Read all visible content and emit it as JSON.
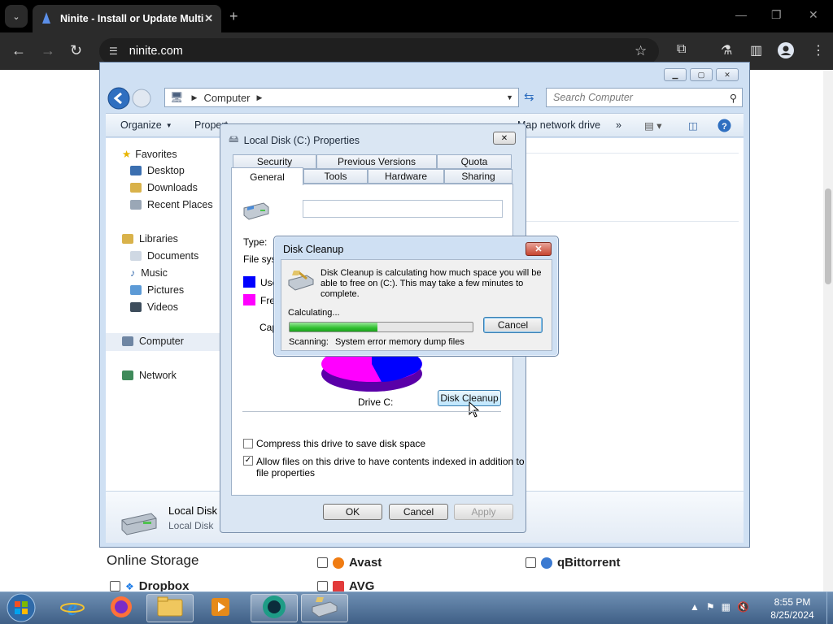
{
  "browser": {
    "tab_title": "Ninite - Install or Update Multi",
    "url": "ninite.com"
  },
  "explorer": {
    "address": "Computer",
    "search_placeholder": "Search Computer",
    "toolbar": {
      "organize": "Organize",
      "properties": "Propert",
      "map_drive": "Map network drive",
      "more": "»"
    },
    "nav": {
      "favorites": "Favorites",
      "desktop": "Desktop",
      "downloads": "Downloads",
      "recent": "Recent Places",
      "libraries": "Libraries",
      "documents": "Documents",
      "music": "Music",
      "pictures": "Pictures",
      "videos": "Videos",
      "computer": "Computer",
      "network": "Network"
    },
    "details": {
      "name": "Local Disk",
      "type": "Local Disk"
    }
  },
  "properties": {
    "title": "Local Disk (C:) Properties",
    "tabs_row1": [
      "Security",
      "Previous Versions",
      "Quota"
    ],
    "tabs_row2": [
      "General",
      "Tools",
      "Hardware",
      "Sharing"
    ],
    "type_label": "Type:",
    "fs_label": "File syst",
    "used_label": "Use",
    "free_label": "Fre",
    "capacity_label": "Cap",
    "drive_label": "Drive C:",
    "disk_cleanup_btn": "Disk Cleanup",
    "compress_label": "Compress this drive to save disk space",
    "index_label_1": "Allow files on this drive to have contents indexed in addition to",
    "index_label_2": "file properties",
    "ok": "OK",
    "cancel": "Cancel",
    "apply": "Apply",
    "colors": {
      "used": "#0000ff",
      "free": "#ff00ff"
    }
  },
  "disk_cleanup": {
    "title": "Disk Cleanup",
    "message_1": "Disk Cleanup is calculating how much space you will be",
    "message_2": "able to free on  (C:). This may take a few minutes to",
    "message_3": "complete.",
    "status": "Calculating...",
    "progress": 0.48,
    "cancel": "Cancel",
    "scanning_label": "Scanning:",
    "scanning_item": "System error memory dump files"
  },
  "web": {
    "section": "Online Storage",
    "apps": [
      "Dropbox",
      "Avast",
      "AVG",
      "qBittorrent"
    ]
  },
  "taskbar": {
    "time": "8:55 PM",
    "date": "8/25/2024"
  }
}
